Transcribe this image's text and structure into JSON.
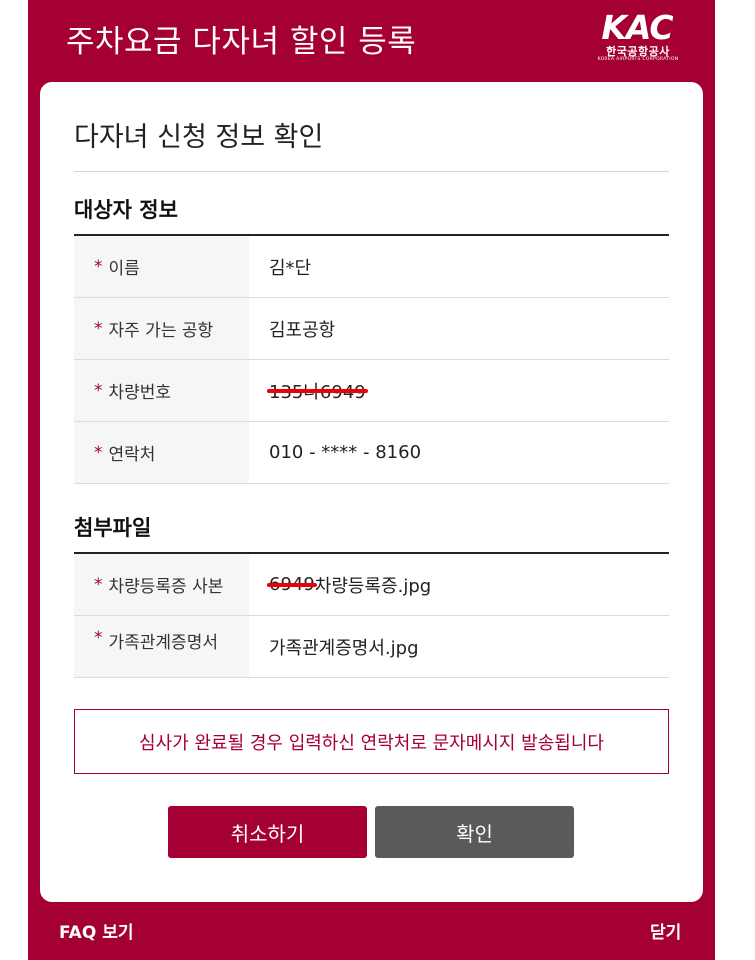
{
  "header": {
    "title": "주차요금 다자녀 할인 등록",
    "logo": {
      "mark_text": "KAC",
      "korean_name": "한국공항공사",
      "english_name": "KOREA AIRPORTS CORPORATION"
    }
  },
  "card": {
    "title": "다자녀 신청 정보 확인",
    "applicant_section": {
      "title": "대상자 정보",
      "rows": [
        {
          "required_mark": "*",
          "label": "이름",
          "value": "김*단"
        },
        {
          "required_mark": "*",
          "label": "자주 가는 공항",
          "value": "김포공항"
        },
        {
          "required_mark": "*",
          "label": "차량번호",
          "value": "135나6949"
        },
        {
          "required_mark": "*",
          "label": "연락처",
          "value": "010 - **** - 8160"
        }
      ]
    },
    "attachment_section": {
      "title": "첨부파일",
      "rows": [
        {
          "required_mark": "*",
          "label": "차량등록증 사본",
          "value_redacted": "6949",
          "value_rest": "차량등록증.jpg"
        },
        {
          "required_mark": "*",
          "label": "가족관계증명서",
          "value": "가족관계증명서.jpg"
        }
      ]
    },
    "notice": "심사가 완료될 경우 입력하신 연락처로 문자메시지 발송됩니다",
    "buttons": {
      "cancel": "취소하기",
      "confirm": "확인"
    }
  },
  "footer": {
    "faq": "FAQ 보기",
    "close": "닫기"
  },
  "colors": {
    "brand": "#a50034",
    "secondary_button": "#5a5a5a",
    "redaction": "#e8000b"
  }
}
